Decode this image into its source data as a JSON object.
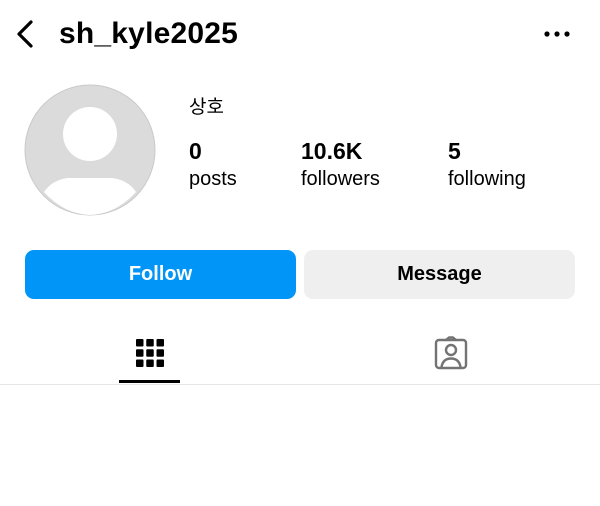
{
  "header": {
    "username": "sh_kyle2025",
    "back_icon": "chevron-left-icon",
    "more_icon": "more-horizontal-icon"
  },
  "profile": {
    "display_name": "상호",
    "avatar_icon": "default-avatar-icon",
    "stats": {
      "posts_value": "0",
      "posts_label": "posts",
      "followers_value": "10.6K",
      "followers_label": "followers",
      "following_value": "5",
      "following_label": "following"
    }
  },
  "actions": {
    "follow_label": "Follow",
    "message_label": "Message"
  },
  "tabs": {
    "posts_icon": "grid-icon",
    "tagged_icon": "tagged-person-icon",
    "active": "posts"
  },
  "colors": {
    "accent": "#0095f6",
    "secondary_button": "#efefef",
    "avatar_bg": "#dbdbdb",
    "divider": "#e6e6e6"
  }
}
